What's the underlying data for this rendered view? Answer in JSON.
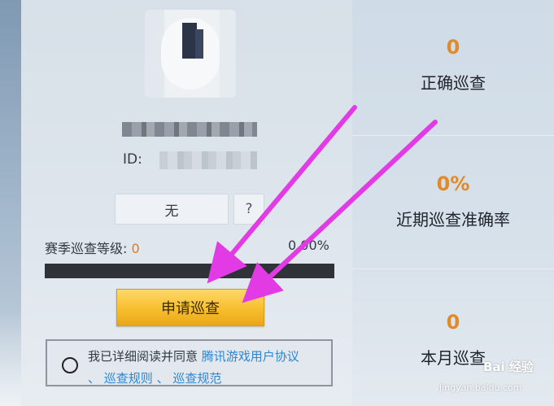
{
  "profile": {
    "id_label": "ID:",
    "title_value": "无",
    "help_label": "?"
  },
  "season": {
    "level_label": "赛季巡查等级:",
    "level_value": "0",
    "progress_text": "0.00%",
    "progress": 0
  },
  "apply_button": "申请巡查",
  "agreement": {
    "text": "我已详细阅读并同意",
    "link1": "腾讯游戏用户协议",
    "sep1": "、",
    "link2": "巡查规则",
    "sep2": "、",
    "link3": "巡查规范"
  },
  "stats": [
    {
      "value": "0",
      "label": "正确巡查"
    },
    {
      "value": "0%",
      "label": "近期巡查准确率"
    },
    {
      "value": "0",
      "label": "本月巡查"
    }
  ],
  "watermark": {
    "brand": "Bai 经验",
    "url": "jingyan.baidu.com"
  },
  "colors": {
    "accent": "#e08a2a",
    "link": "#2a86d6",
    "button": "#f7be2c",
    "arrow": "#e23be6"
  }
}
